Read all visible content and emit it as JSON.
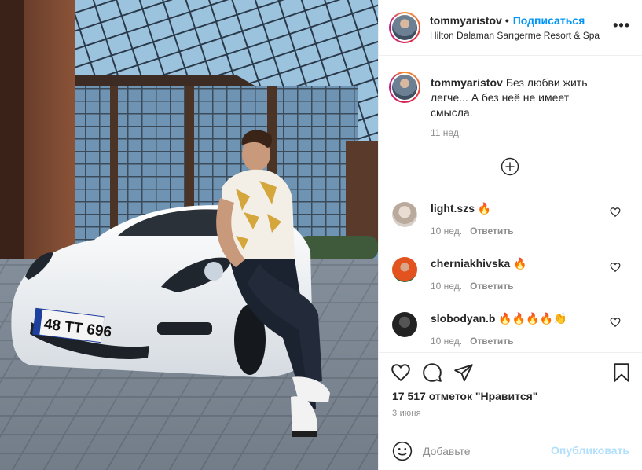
{
  "post": {
    "author": "tommyaristov",
    "follow_label": "Подписаться",
    "dot": "•",
    "location": "Hilton Dalaman Sarıgerme Resort & Spa",
    "more_label": "•••",
    "caption": "Без любви жить легче... А без неё не имеет смысла.",
    "caption_time": "11 нед.",
    "likes": "17 517 отметок \"Нравится\"",
    "date": "3 июня",
    "photo_plate": "48 TT 696"
  },
  "comments": [
    {
      "user": "light.szs",
      "text": "🔥",
      "time": "10 нед.",
      "reply": "Ответить"
    },
    {
      "user": "cherniakhivska",
      "text": "🔥",
      "time": "10 нед.",
      "reply": "Ответить"
    },
    {
      "user": "slobodyan.b",
      "text": "🔥🔥🔥🔥👏",
      "time": "10 нед.",
      "reply": "Ответить"
    }
  ],
  "add_comment": {
    "placeholder": "Добавьте",
    "publish_label": "Опубликовать"
  },
  "colors": {
    "accent": "#0095f6",
    "publish_disabled": "#b2dffc",
    "meta": "#8e8e8e",
    "text": "#262626"
  },
  "icons": [
    "more-icon",
    "plus-circle-icon",
    "heart-icon",
    "comment-icon",
    "share-icon",
    "bookmark-icon",
    "emoji-icon"
  ]
}
